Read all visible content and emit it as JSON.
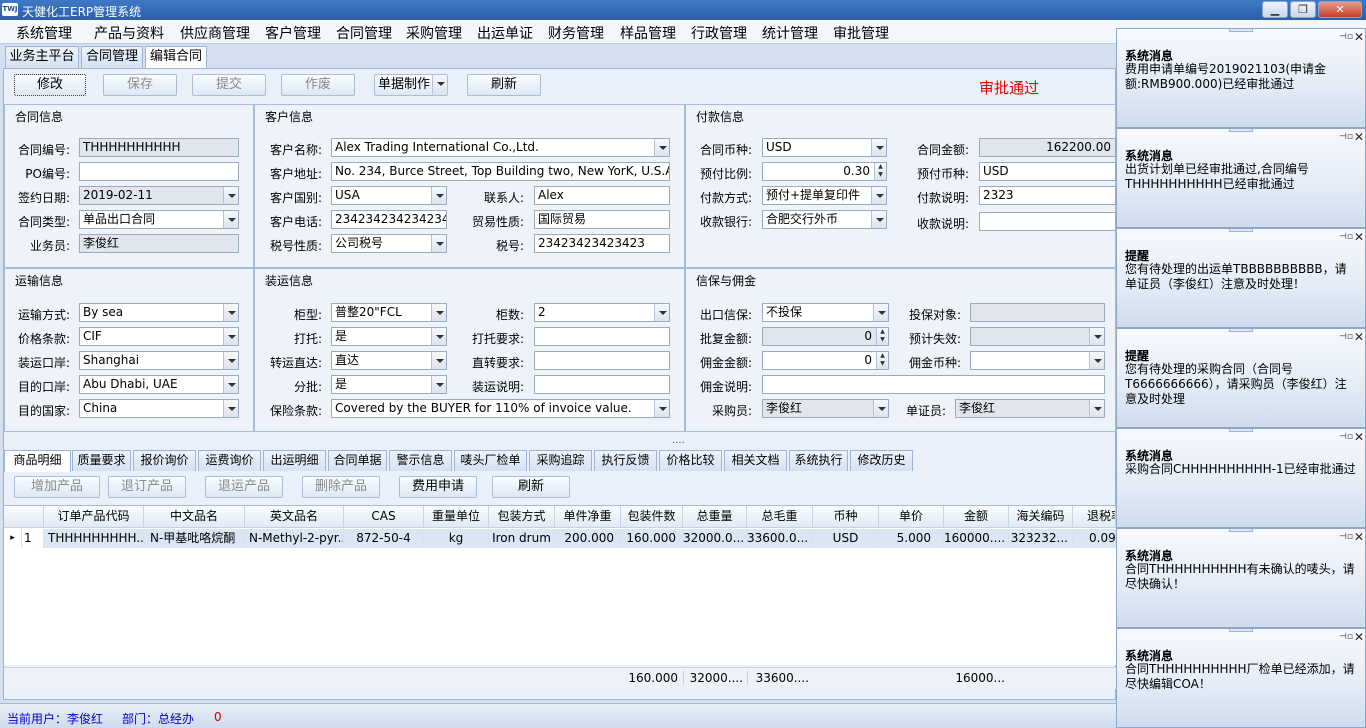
{
  "window": {
    "logo": "TWJ",
    "title": "天健化工ERP管理系统",
    "btn_min": "▁",
    "btn_max": "❐",
    "btn_close": "✕"
  },
  "menu": [
    "系统管理",
    "产品与资料",
    "供应商管理",
    "客户管理",
    "合同管理",
    "采购管理",
    "出运单证",
    "财务管理",
    "样品管理",
    "行政管理",
    "统计管理",
    "审批管理"
  ],
  "top_tabs": [
    "业务主平台",
    "合同管理",
    "编辑合同"
  ],
  "toolbar": {
    "edit": "修改",
    "save": "保存",
    "submit": "提交",
    "void": "作废",
    "doc_make": "单据制作",
    "refresh": "刷新",
    "status": "审批通过"
  },
  "contract": {
    "title": "合同信息",
    "no_label": "合同编号:",
    "no": "THHHHHHHHHH",
    "po_label": "PO编号:",
    "po": "",
    "date_label": "签约日期:",
    "date": "2019-02-11",
    "type_label": "合同类型:",
    "type": "单品出口合同",
    "sales_label": "业务员:",
    "sales": "李俊红"
  },
  "customer": {
    "title": "客户信息",
    "name_label": "客户名称:",
    "name": "Alex Trading International Co.,Ltd.",
    "addr_label": "客户地址:",
    "addr": "No. 234, Burce Street, Top Building two, New YorK, U.S.A.",
    "country_label": "客户国别:",
    "country": "USA",
    "contact_label": "联系人:",
    "contact": "Alex",
    "phone_label": "客户电话:",
    "phone": "234234234234234",
    "trade_label": "贸易性质:",
    "trade": "国际贸易",
    "taxtype_label": "税号性质:",
    "taxtype": "公司税号",
    "taxno_label": "税号:",
    "taxno": "23423423423423"
  },
  "payment": {
    "title": "付款信息",
    "currency_label": "合同币种:",
    "currency": "USD",
    "amount_label": "合同金额:",
    "amount": "162200.00",
    "ratio_label": "预付比例:",
    "ratio": "0.30",
    "precur_label": "预付币种:",
    "precur": "USD",
    "method_label": "付款方式:",
    "method": "预付+提单复印件",
    "desc_label": "付款说明:",
    "desc": "2323",
    "bank_label": "收款银行:",
    "bank": "合肥交行外币",
    "bankdesc_label": "收款说明:",
    "bankdesc": ""
  },
  "transport": {
    "title": "运输信息",
    "mode_label": "运输方式:",
    "mode": "By sea",
    "term_label": "价格条款:",
    "term": "CIF",
    "pol_label": "装运口岸:",
    "pol": "Shanghai",
    "pod_label": "目的口岸:",
    "pod": "Abu Dhabi, UAE",
    "dest_label": "目的国家:",
    "dest": "China"
  },
  "shipping": {
    "title": "装运信息",
    "cont_label": "柜型:",
    "cont": "普整20\"FCL",
    "count_label": "柜数:",
    "count": "2",
    "pallet_label": "打托:",
    "pallet": "是",
    "palletreq_label": "打托要求:",
    "palletreq": "",
    "direct_label": "转运直达:",
    "direct": "直达",
    "directreq_label": "直转要求:",
    "directreq": "",
    "split_label": "分批:",
    "split": "是",
    "shipdesc_label": "装运说明:",
    "shipdesc": "",
    "ins_label": "保险条款:",
    "ins": "Covered by the BUYER for 110% of invoice value."
  },
  "credit": {
    "title": "信保与佣金",
    "ins_label": "出口信保:",
    "ins": "不投保",
    "insobj_label": "投保对象:",
    "insobj": "",
    "approve_label": "批复金额:",
    "approve": "0",
    "expire_label": "预计失效:",
    "expire": "",
    "comm_label": "佣金金额:",
    "comm": "0",
    "commcur_label": "佣金币种:",
    "commcur": "",
    "commdesc_label": "佣金说明:",
    "commdesc": "",
    "buyer_label": "采购员:",
    "buyer": "李俊红",
    "doc_label": "单证员:",
    "doc": "李俊红"
  },
  "splitter": "....",
  "detail_tabs": [
    "商品明细",
    "质量要求",
    "报价询价",
    "运费询价",
    "出运明细",
    "合同单据",
    "警示信息",
    "唛头厂检单",
    "采购追踪",
    "执行反馈",
    "价格比较",
    "相关文档",
    "系统执行",
    "修改历史"
  ],
  "detail_toolbar": {
    "add": "增加产品",
    "cancel": "退订产品",
    "return": "退运产品",
    "delete": "删除产品",
    "fee": "费用申请",
    "refresh": "刷新"
  },
  "grid": {
    "headers": [
      "订单产品代码",
      "中文品名",
      "英文品名",
      "CAS",
      "重量单位",
      "包装方式",
      "单件净重",
      "包装件数",
      "总重量",
      "总毛重",
      "币种",
      "单价",
      "金额",
      "海关编码",
      "退税率"
    ],
    "rows": [
      {
        "marker": "▸",
        "index": "1",
        "cells": [
          "THHHHHHHHH...",
          "N-甲基吡咯烷酮",
          "N-Methyl-2-pyr...",
          "872-50-4",
          "kg",
          "Iron drum",
          "200.000",
          "160.000",
          "32000.0...",
          "33600.0...",
          "USD",
          "5.000",
          "160000....",
          "323232...",
          "0.090"
        ]
      }
    ],
    "footer": {
      "pieces": "160.000",
      "weight": "32000....",
      "gross": "33600....",
      "amount": "16000..."
    }
  },
  "statusbar": {
    "user": "当前用户：李俊红",
    "dept": "部门：总经办",
    "count": "0"
  },
  "notifications": [
    {
      "title": "系统消息",
      "body": "费用申请单编号2019021103(申请金额:RMB900.000)已经审批通过"
    },
    {
      "title": "系统消息",
      "body": "出货计划单已经审批通过,合同编号THHHHHHHHHH已经审批通过"
    },
    {
      "title": "提醒",
      "body": "您有待处理的出运单TBBBBBBBBBB，请单证员（李俊红）注意及时处理！"
    },
    {
      "title": "提醒",
      "body": "您有待处理的采购合同（合同号T6666666666），请采购员（李俊红）注意及时处理"
    },
    {
      "title": "系统消息",
      "body": "采购合同CHHHHHHHHHH-1已经审批通过"
    },
    {
      "title": "系统消息",
      "body": "合同THHHHHHHHHH有未确认的唛头，请尽快确认！"
    },
    {
      "title": "系统消息",
      "body": "合同THHHHHHHHHH厂检单已经添加，请尽快编辑COA！"
    }
  ],
  "note_controls": {
    "pin": "⊣▫",
    "close": "✕"
  }
}
